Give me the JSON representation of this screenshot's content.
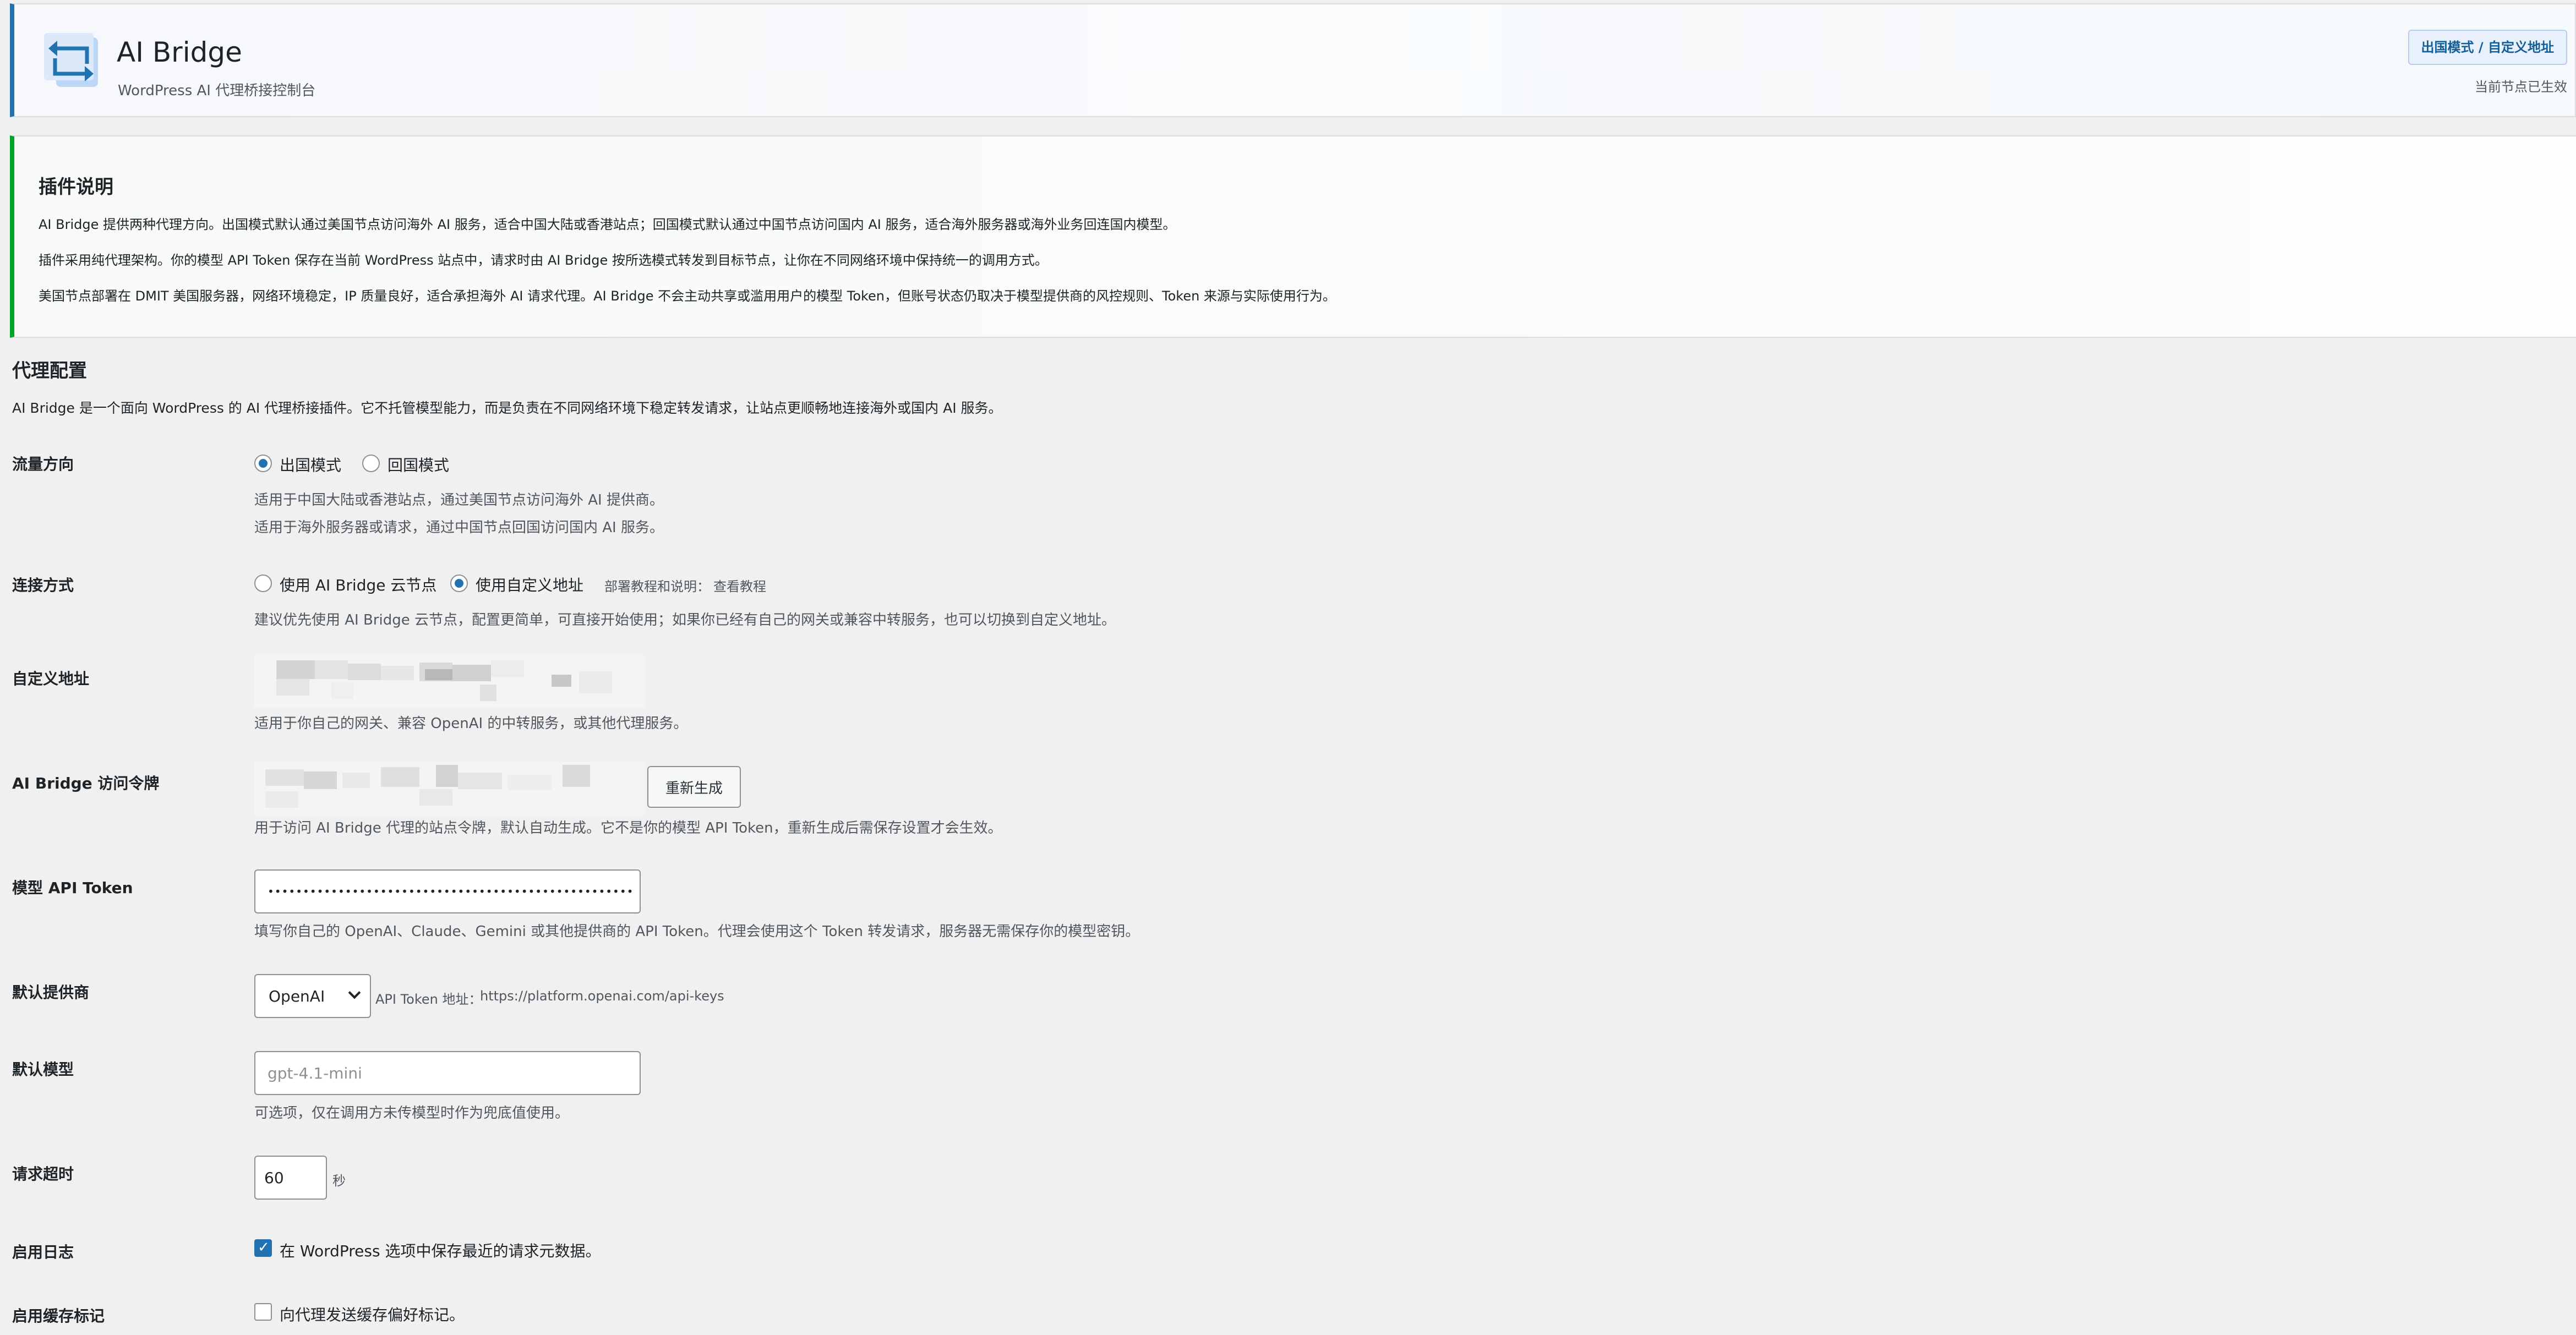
{
  "header": {
    "title": "AI Bridge",
    "subtitle": "WordPress AI 代理桥接控制台",
    "mode_badge": "出国模式 / 自定义地址",
    "mode_status": "当前节点已生效",
    "logo_icon": "swap-arrows-icon"
  },
  "notice": {
    "title": "插件说明",
    "paragraphs": [
      "AI Bridge 提供两种代理方向。出国模式默认通过美国节点访问海外 AI 服务，适合中国大陆或香港站点；回国模式默认通过中国节点访问国内 AI 服务，适合海外服务器或海外业务回连国内模型。",
      "插件采用纯代理架构。你的模型 API Token 保存在当前 WordPress 站点中，请求时由 AI Bridge 按所选模式转发到目标节点，让你在不同网络环境中保持统一的调用方式。",
      "美国节点部署在 DMIT 美国服务器，网络环境稳定，IP 质量良好，适合承担海外 AI 请求代理。AI Bridge 不会主动共享或滥用用户的模型 Token，但账号状态仍取决于模型提供商的风控规则、Token 来源与实际使用行为。"
    ]
  },
  "section": {
    "title": "代理配置",
    "description": "AI Bridge 是一个面向 WordPress 的 AI 代理桥接插件。它不托管模型能力，而是负责在不同网络环境下稳定转发请求，让站点更顺畅地连接海外或国内 AI 服务。"
  },
  "fields": {
    "traffic": {
      "label": "流量方向",
      "option_out": "出国模式",
      "option_back": "回国模式",
      "selected": "出国模式",
      "desc_out": "适用于中国大陆或香港站点，通过美国节点访问海外 AI 提供商。",
      "desc_back": "适用于海外服务器或请求，通过中国节点回国访问国内 AI 服务。"
    },
    "connection": {
      "label": "连接方式",
      "option_cloud": "使用 AI Bridge 云节点",
      "option_custom": "使用自定义地址",
      "selected": "使用自定义地址",
      "tutorial_prefix": "部署教程和说明：",
      "tutorial_link": "查看教程",
      "desc": "建议优先使用 AI Bridge 云节点，配置更简单，可直接开始使用；如果你已经有自己的网关或兼容中转服务，也可以切换到自定义地址。"
    },
    "custom_url": {
      "label": "自定义地址",
      "desc": "适用于你自己的网关、兼容 OpenAI 的中转服务，或其他代理服务。"
    },
    "access_token": {
      "label": "AI Bridge 访问令牌",
      "regenerate": "重新生成",
      "desc": "用于访问 AI Bridge 代理的站点令牌，默认自动生成。它不是你的模型 API Token，重新生成后需保存设置才会生效。"
    },
    "api_token": {
      "label": "模型 API Token",
      "value": "••••••••••••••••••••••••••••••••••••••••••••••••••••",
      "desc": "填写你自己的 OpenAI、Claude、Gemini 或其他提供商的 API Token。代理会使用这个 Token 转发请求，服务器无需保存你的模型密钥。"
    },
    "provider": {
      "label": "默认提供商",
      "selected": "OpenAI",
      "token_prefix": "API Token 地址：",
      "token_link": "https://platform.openai.com/api-keys"
    },
    "model": {
      "label": "默认模型",
      "placeholder": "gpt-4.1-mini",
      "desc": "可选项，仅在调用方未传模型时作为兜底值使用。"
    },
    "timeout": {
      "label": "请求超时",
      "value": "60",
      "unit": "秒"
    },
    "logging": {
      "label": "启用日志",
      "checked": true,
      "text": "在 WordPress 选项中保存最近的请求元数据。"
    },
    "cache": {
      "label": "启用缓存标记",
      "checked": false,
      "text": "向代理发送缓存偏好标记。"
    }
  }
}
